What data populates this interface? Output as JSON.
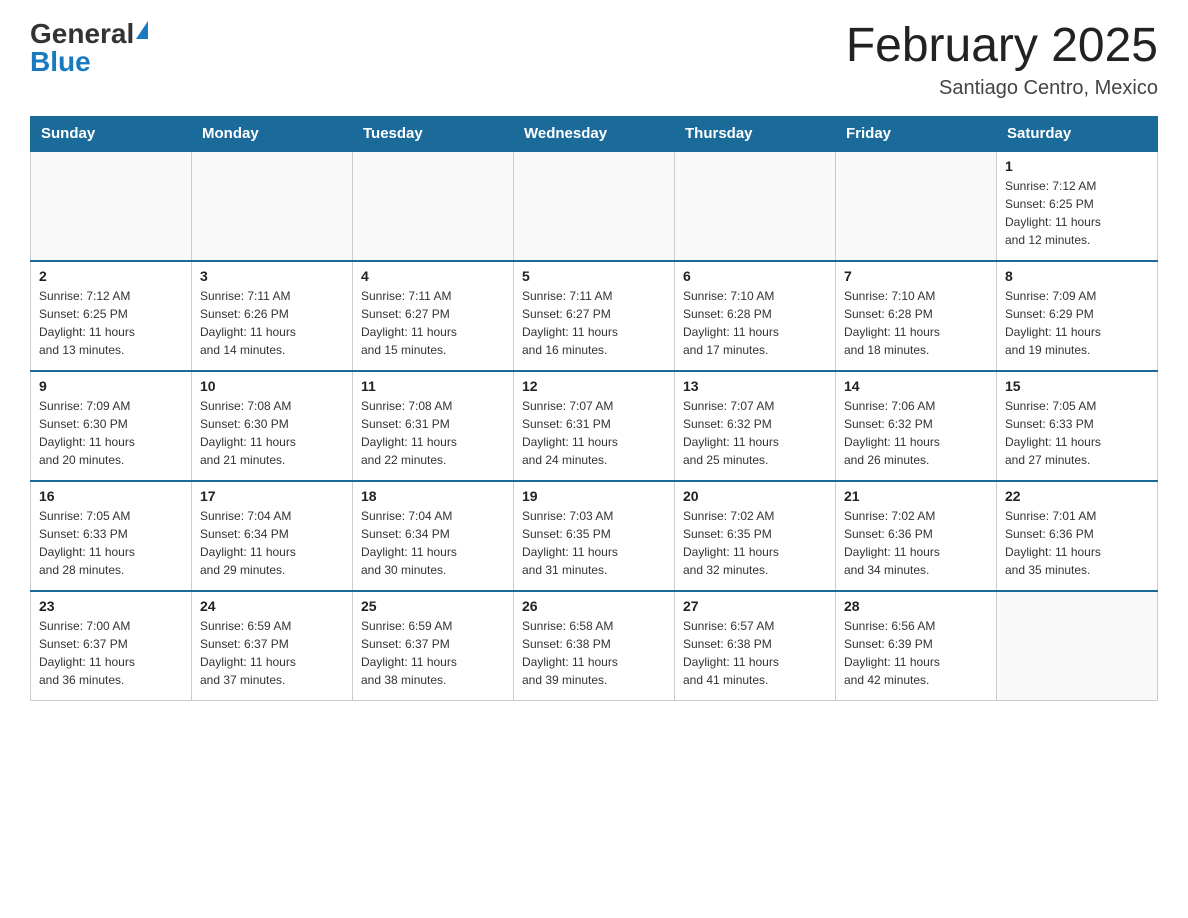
{
  "header": {
    "logo_general": "General",
    "logo_blue": "Blue",
    "title": "February 2025",
    "subtitle": "Santiago Centro, Mexico"
  },
  "days_of_week": [
    "Sunday",
    "Monday",
    "Tuesday",
    "Wednesday",
    "Thursday",
    "Friday",
    "Saturday"
  ],
  "weeks": [
    [
      {
        "day": "",
        "info": ""
      },
      {
        "day": "",
        "info": ""
      },
      {
        "day": "",
        "info": ""
      },
      {
        "day": "",
        "info": ""
      },
      {
        "day": "",
        "info": ""
      },
      {
        "day": "",
        "info": ""
      },
      {
        "day": "1",
        "info": "Sunrise: 7:12 AM\nSunset: 6:25 PM\nDaylight: 11 hours\nand 12 minutes."
      }
    ],
    [
      {
        "day": "2",
        "info": "Sunrise: 7:12 AM\nSunset: 6:25 PM\nDaylight: 11 hours\nand 13 minutes."
      },
      {
        "day": "3",
        "info": "Sunrise: 7:11 AM\nSunset: 6:26 PM\nDaylight: 11 hours\nand 14 minutes."
      },
      {
        "day": "4",
        "info": "Sunrise: 7:11 AM\nSunset: 6:27 PM\nDaylight: 11 hours\nand 15 minutes."
      },
      {
        "day": "5",
        "info": "Sunrise: 7:11 AM\nSunset: 6:27 PM\nDaylight: 11 hours\nand 16 minutes."
      },
      {
        "day": "6",
        "info": "Sunrise: 7:10 AM\nSunset: 6:28 PM\nDaylight: 11 hours\nand 17 minutes."
      },
      {
        "day": "7",
        "info": "Sunrise: 7:10 AM\nSunset: 6:28 PM\nDaylight: 11 hours\nand 18 minutes."
      },
      {
        "day": "8",
        "info": "Sunrise: 7:09 AM\nSunset: 6:29 PM\nDaylight: 11 hours\nand 19 minutes."
      }
    ],
    [
      {
        "day": "9",
        "info": "Sunrise: 7:09 AM\nSunset: 6:30 PM\nDaylight: 11 hours\nand 20 minutes."
      },
      {
        "day": "10",
        "info": "Sunrise: 7:08 AM\nSunset: 6:30 PM\nDaylight: 11 hours\nand 21 minutes."
      },
      {
        "day": "11",
        "info": "Sunrise: 7:08 AM\nSunset: 6:31 PM\nDaylight: 11 hours\nand 22 minutes."
      },
      {
        "day": "12",
        "info": "Sunrise: 7:07 AM\nSunset: 6:31 PM\nDaylight: 11 hours\nand 24 minutes."
      },
      {
        "day": "13",
        "info": "Sunrise: 7:07 AM\nSunset: 6:32 PM\nDaylight: 11 hours\nand 25 minutes."
      },
      {
        "day": "14",
        "info": "Sunrise: 7:06 AM\nSunset: 6:32 PM\nDaylight: 11 hours\nand 26 minutes."
      },
      {
        "day": "15",
        "info": "Sunrise: 7:05 AM\nSunset: 6:33 PM\nDaylight: 11 hours\nand 27 minutes."
      }
    ],
    [
      {
        "day": "16",
        "info": "Sunrise: 7:05 AM\nSunset: 6:33 PM\nDaylight: 11 hours\nand 28 minutes."
      },
      {
        "day": "17",
        "info": "Sunrise: 7:04 AM\nSunset: 6:34 PM\nDaylight: 11 hours\nand 29 minutes."
      },
      {
        "day": "18",
        "info": "Sunrise: 7:04 AM\nSunset: 6:34 PM\nDaylight: 11 hours\nand 30 minutes."
      },
      {
        "day": "19",
        "info": "Sunrise: 7:03 AM\nSunset: 6:35 PM\nDaylight: 11 hours\nand 31 minutes."
      },
      {
        "day": "20",
        "info": "Sunrise: 7:02 AM\nSunset: 6:35 PM\nDaylight: 11 hours\nand 32 minutes."
      },
      {
        "day": "21",
        "info": "Sunrise: 7:02 AM\nSunset: 6:36 PM\nDaylight: 11 hours\nand 34 minutes."
      },
      {
        "day": "22",
        "info": "Sunrise: 7:01 AM\nSunset: 6:36 PM\nDaylight: 11 hours\nand 35 minutes."
      }
    ],
    [
      {
        "day": "23",
        "info": "Sunrise: 7:00 AM\nSunset: 6:37 PM\nDaylight: 11 hours\nand 36 minutes."
      },
      {
        "day": "24",
        "info": "Sunrise: 6:59 AM\nSunset: 6:37 PM\nDaylight: 11 hours\nand 37 minutes."
      },
      {
        "day": "25",
        "info": "Sunrise: 6:59 AM\nSunset: 6:37 PM\nDaylight: 11 hours\nand 38 minutes."
      },
      {
        "day": "26",
        "info": "Sunrise: 6:58 AM\nSunset: 6:38 PM\nDaylight: 11 hours\nand 39 minutes."
      },
      {
        "day": "27",
        "info": "Sunrise: 6:57 AM\nSunset: 6:38 PM\nDaylight: 11 hours\nand 41 minutes."
      },
      {
        "day": "28",
        "info": "Sunrise: 6:56 AM\nSunset: 6:39 PM\nDaylight: 11 hours\nand 42 minutes."
      },
      {
        "day": "",
        "info": ""
      }
    ]
  ]
}
